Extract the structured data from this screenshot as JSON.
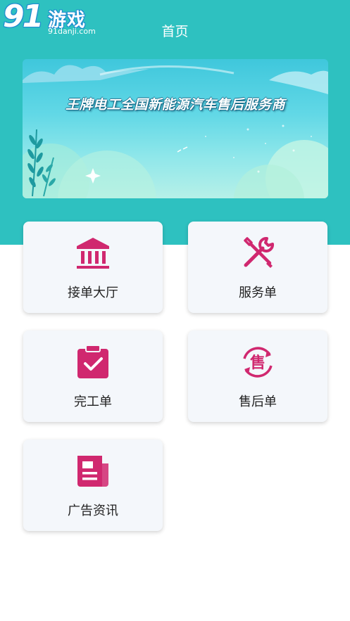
{
  "watermark": {
    "number": "91",
    "text": "游戏",
    "url": "91danji.com"
  },
  "header": {
    "title": "首页"
  },
  "banner": {
    "text": "王牌电工全国新能源汽车售后服务商"
  },
  "menu": [
    {
      "label": "接单大厅",
      "icon": "bank-icon"
    },
    {
      "label": "服务单",
      "icon": "tools-icon"
    },
    {
      "label": "完工单",
      "icon": "clipboard-check-icon"
    },
    {
      "label": "售后单",
      "icon": "after-sale-icon",
      "icon_text": "售"
    },
    {
      "label": "广告资讯",
      "icon": "news-icon"
    }
  ],
  "colors": {
    "header_bg": "#2ec1c0",
    "icon_accent": "#d0286f",
    "card_bg": "#f4f7fb"
  }
}
